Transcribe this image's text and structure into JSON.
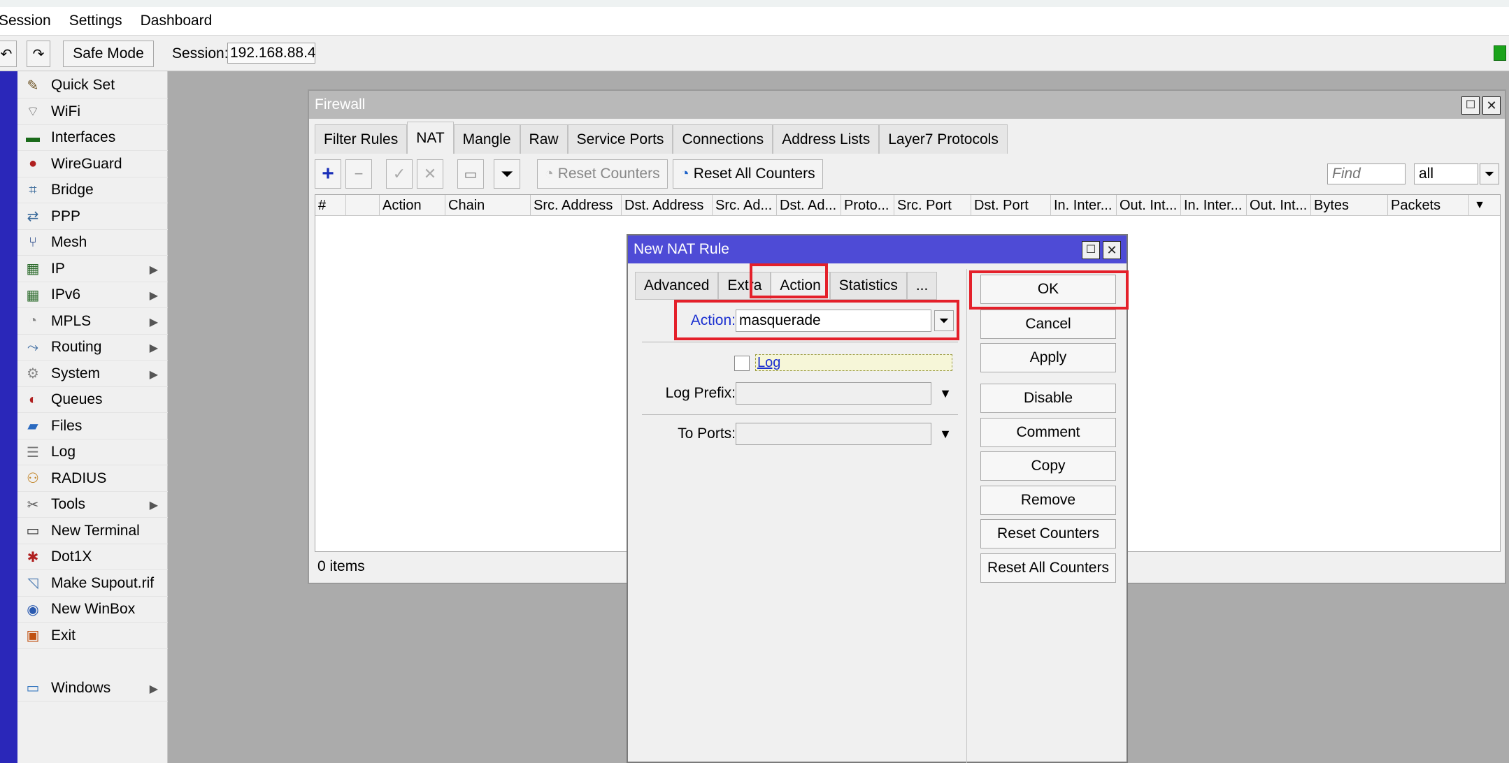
{
  "menu": [
    "Session",
    "Settings",
    "Dashboard"
  ],
  "toolbar": {
    "safe_mode": "Safe Mode",
    "session_label": "Session:",
    "session_value": "192.168.88.4"
  },
  "sidebar": [
    {
      "label": "Quick Set",
      "icon": "wand-icon",
      "sub": false
    },
    {
      "label": "WiFi",
      "icon": "wifi-icon",
      "sub": false
    },
    {
      "label": "Interfaces",
      "icon": "interfaces-icon",
      "sub": false
    },
    {
      "label": "WireGuard",
      "icon": "wireguard-icon",
      "sub": false
    },
    {
      "label": "Bridge",
      "icon": "bridge-icon",
      "sub": false
    },
    {
      "label": "PPP",
      "icon": "ppp-icon",
      "sub": false
    },
    {
      "label": "Mesh",
      "icon": "mesh-icon",
      "sub": false
    },
    {
      "label": "IP",
      "icon": "ip-icon",
      "sub": true
    },
    {
      "label": "IPv6",
      "icon": "ipv6-icon",
      "sub": true
    },
    {
      "label": "MPLS",
      "icon": "mpls-icon",
      "sub": true
    },
    {
      "label": "Routing",
      "icon": "routing-icon",
      "sub": true
    },
    {
      "label": "System",
      "icon": "system-icon",
      "sub": true
    },
    {
      "label": "Queues",
      "icon": "queues-icon",
      "sub": false
    },
    {
      "label": "Files",
      "icon": "folder-icon",
      "sub": false
    },
    {
      "label": "Log",
      "icon": "log-icon",
      "sub": false
    },
    {
      "label": "RADIUS",
      "icon": "radius-icon",
      "sub": false
    },
    {
      "label": "Tools",
      "icon": "tools-icon",
      "sub": true
    },
    {
      "label": "New Terminal",
      "icon": "terminal-icon",
      "sub": false
    },
    {
      "label": "Dot1X",
      "icon": "dot1x-icon",
      "sub": false
    },
    {
      "label": "Make Supout.rif",
      "icon": "supout-icon",
      "sub": false
    },
    {
      "label": "New WinBox",
      "icon": "winbox-icon",
      "sub": false
    },
    {
      "label": "Exit",
      "icon": "exit-icon",
      "sub": false
    },
    {
      "label": "Windows",
      "icon": "windows-icon",
      "sub": true
    }
  ],
  "firewall": {
    "title": "Firewall",
    "tabs": [
      "Filter Rules",
      "NAT",
      "Mangle",
      "Raw",
      "Service Ports",
      "Connections",
      "Address Lists",
      "Layer7 Protocols"
    ],
    "active_tab": "NAT",
    "reset_counters": "Reset Counters",
    "reset_all_counters": "Reset All Counters",
    "find_placeholder": "Find",
    "filter_value": "all",
    "columns": [
      "#",
      "",
      "Action",
      "Chain",
      "Src. Address",
      "Dst. Address",
      "Src. Ad...",
      "Dst. Ad...",
      "Proto...",
      "Src. Port",
      "Dst. Port",
      "In. Inter...",
      "Out. Int...",
      "In. Inter...",
      "Out. Int...",
      "Bytes",
      "Packets"
    ],
    "status": "0 items"
  },
  "nat_dialog": {
    "title": "New NAT Rule",
    "tabs": [
      "Advanced",
      "Extra",
      "Action",
      "Statistics",
      "..."
    ],
    "active_tab": "Action",
    "action_label": "Action:",
    "action_value": "masquerade",
    "log_label": "Log",
    "log_checked": false,
    "log_prefix_label": "Log Prefix:",
    "log_prefix_value": "",
    "to_ports_label": "To Ports:",
    "to_ports_value": "",
    "buttons": [
      "OK",
      "Cancel",
      "Apply",
      "Disable",
      "Comment",
      "Copy",
      "Remove",
      "Reset Counters",
      "Reset All Counters"
    ]
  },
  "colors": {
    "highlight": "#e4202a",
    "dialog_title": "#4e4bd6",
    "sidebar_stripe": "#2a27b9"
  }
}
